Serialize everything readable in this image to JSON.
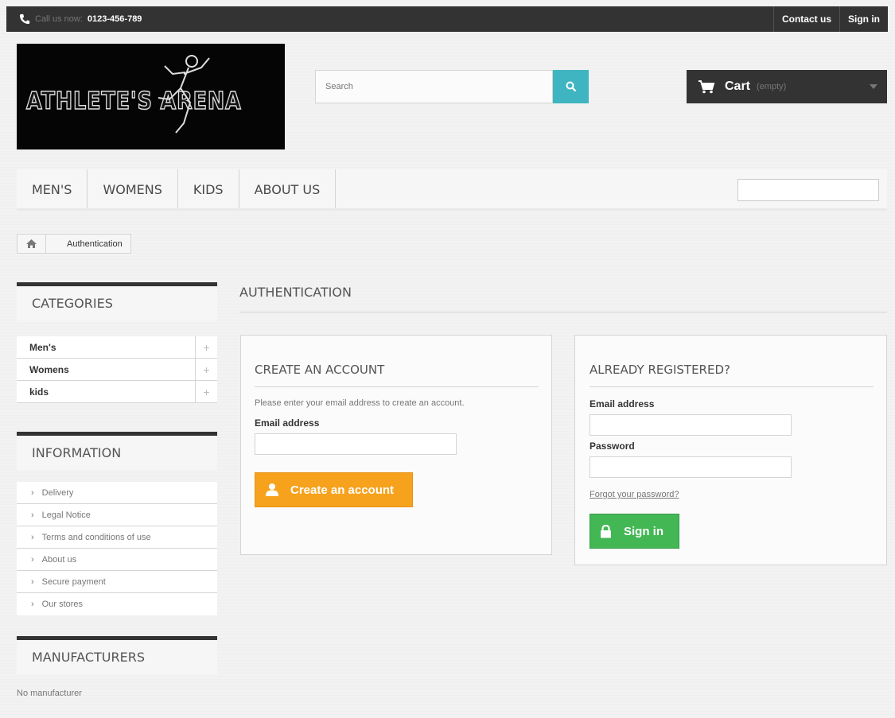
{
  "topbar": {
    "call_label": "Call us now:",
    "phone": "0123-456-789",
    "links": [
      "Contact us",
      "Sign in"
    ]
  },
  "logo": {
    "text": "ATHLETE'S ARENA"
  },
  "search": {
    "placeholder": "Search"
  },
  "cart": {
    "label": "Cart",
    "status": "(empty)"
  },
  "menu": {
    "items": [
      "MEN'S",
      "WOMENS",
      "KIDS",
      "ABOUT US"
    ]
  },
  "breadcrumb": {
    "current": "Authentication"
  },
  "sidebar": {
    "categories": {
      "title": "CATEGORIES",
      "items": [
        "Men's",
        "Womens",
        "kids"
      ]
    },
    "information": {
      "title": "INFORMATION",
      "items": [
        "Delivery",
        "Legal Notice",
        "Terms and conditions of use",
        "About us",
        "Secure payment",
        "Our stores"
      ]
    },
    "manufacturers": {
      "title": "MANUFACTURERS",
      "empty_text": "No manufacturer"
    }
  },
  "main": {
    "heading": "AUTHENTICATION",
    "create": {
      "title": "CREATE AN ACCOUNT",
      "description": "Please enter your email address to create an account.",
      "email_label": "Email address",
      "button": "Create an account"
    },
    "login": {
      "title": "ALREADY REGISTERED?",
      "email_label": "Email address",
      "password_label": "Password",
      "forgot": "Forgot your password?",
      "button": "Sign in"
    }
  },
  "colors": {
    "dark_bar": "#333333",
    "search_button": "#3fb5c1",
    "create_button": "#f7a21d",
    "signin_button": "#43b754"
  }
}
